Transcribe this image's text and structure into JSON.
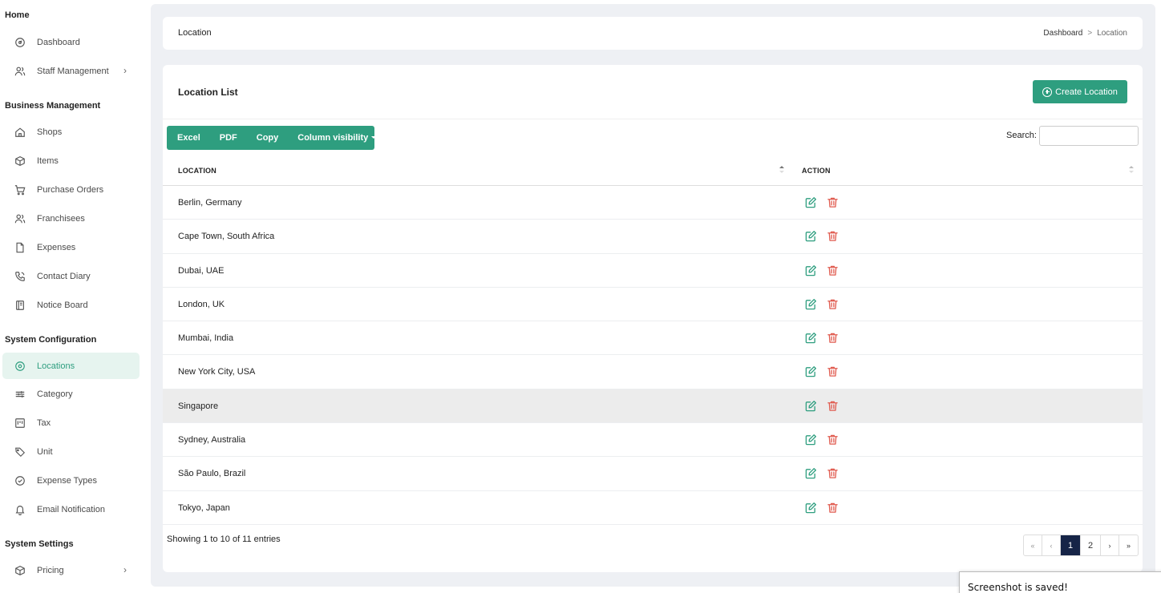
{
  "sidebar": {
    "sections": {
      "home": "Home",
      "business": "Business Management",
      "config": "System Configuration",
      "settings": "System Settings"
    },
    "items": {
      "dashboard": "Dashboard",
      "staff": "Staff Management",
      "shops": "Shops",
      "items": "Items",
      "purchase_orders": "Purchase Orders",
      "franchisees": "Franchisees",
      "expenses": "Expenses",
      "contact_diary": "Contact Diary",
      "notice_board": "Notice Board",
      "locations": "Locations",
      "category": "Category",
      "tax": "Tax",
      "unit": "Unit",
      "expense_types": "Expense Types",
      "email_notification": "Email Notification",
      "pricing": "Pricing"
    },
    "active_item": "locations",
    "colors": {
      "active_bg": "#e6f4ef",
      "active_text": "#2e9e7f"
    }
  },
  "header": {
    "title": "Location",
    "breadcrumb": {
      "root": "Dashboard",
      "separator": ">",
      "current": "Location"
    }
  },
  "card": {
    "title": "Location List",
    "create_button": "Create Location",
    "toolbar": {
      "excel": "Excel",
      "pdf": "PDF",
      "copy": "Copy",
      "column_visibility": "Column visibility"
    },
    "search": {
      "label": "Search:",
      "value": "",
      "placeholder": ""
    },
    "columns": {
      "location": "LOCATION",
      "action": "ACTION"
    },
    "rows": [
      "Berlin, Germany",
      "Cape Town, South Africa",
      "Dubai, UAE",
      "London, UK",
      "Mumbai, India",
      "New York City, USA",
      "Singapore",
      "Sydney, Australia",
      "São Paulo, Brazil",
      "Tokyo, Japan"
    ],
    "highlighted_row": "Singapore",
    "row_actions": [
      "edit-icon",
      "delete-icon"
    ],
    "info": "Showing 1 to 10 of 11 entries",
    "pagination": {
      "first": "«",
      "prev": "‹",
      "pages": [
        "1",
        "2"
      ],
      "current": "1",
      "next": "›",
      "last": "»"
    }
  },
  "toast": {
    "message": "Screenshot is saved!"
  },
  "colors": {
    "accent": "#2e9e7f",
    "danger": "#e05a4e",
    "page_active": "#162447"
  }
}
